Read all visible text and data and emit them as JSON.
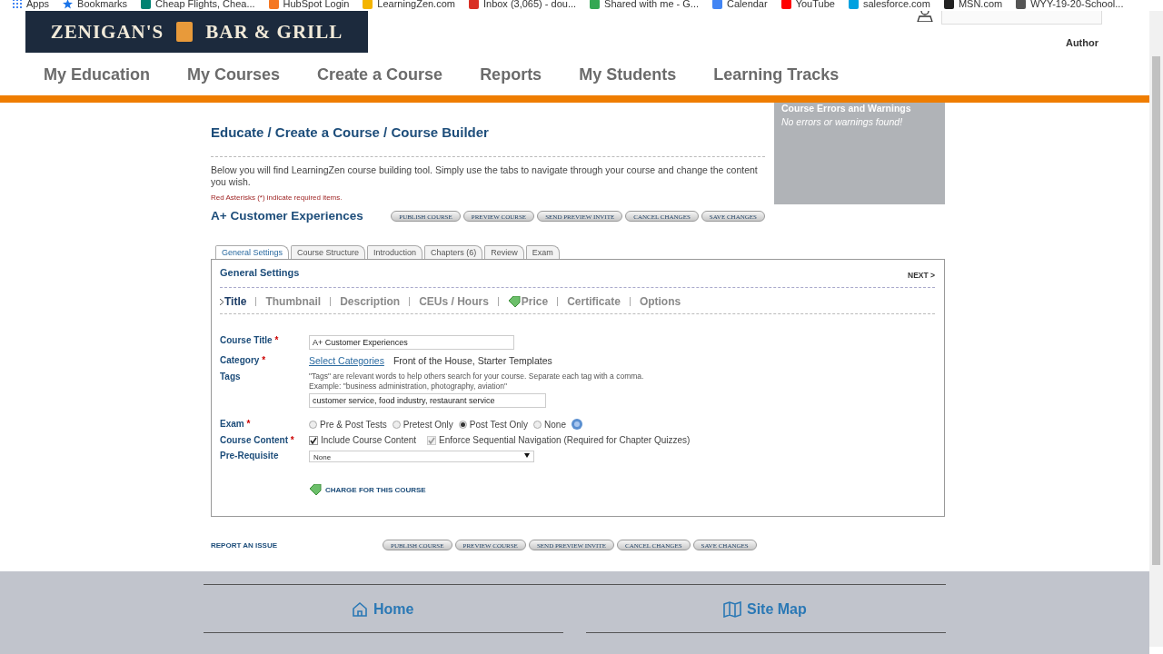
{
  "bookmarks": [
    {
      "label": "Apps",
      "kind": "grid",
      "color": "#4285f4"
    },
    {
      "label": "Bookmarks",
      "kind": "star",
      "color": "#1a73e8"
    },
    {
      "label": "Cheap Flights, Chea...",
      "kind": "square",
      "color": "#008272"
    },
    {
      "label": "HubSpot Login",
      "kind": "square",
      "color": "#f57722"
    },
    {
      "label": "LearningZen.com",
      "kind": "square",
      "color": "#f4b400"
    },
    {
      "label": "Inbox (3,065) - dou...",
      "kind": "square",
      "color": "#d93025"
    },
    {
      "label": "Shared with me - G...",
      "kind": "square",
      "color": "#34a853"
    },
    {
      "label": "Calendar",
      "kind": "square",
      "color": "#4285f4"
    },
    {
      "label": "YouTube",
      "kind": "square",
      "color": "#ff0000"
    },
    {
      "label": "salesforce.com",
      "kind": "square",
      "color": "#00a1e0"
    },
    {
      "label": "MSN.com",
      "kind": "square",
      "color": "#222222"
    },
    {
      "label": "WYY-19-20-School...",
      "kind": "square",
      "color": "#555555"
    }
  ],
  "header": {
    "logo": {
      "left": "ZENIGAN'S",
      "right": "BAR & GRILL"
    },
    "role": "Author"
  },
  "nav": [
    "My Education",
    "My Courses",
    "Create a Course",
    "Reports",
    "My Students",
    "Learning Tracks"
  ],
  "errors_panel": {
    "title": "Course Errors and Warnings",
    "message": "No errors or warnings found!"
  },
  "breadcrumb": "Educate / Create a Course / Course Builder",
  "intro": "Below you will find LearningZen course building tool. Simply use the tabs to navigate through your course and change the content you wish.",
  "required_note": "Red Asterisks (*) indicate required items.",
  "course_name": "A+ Customer Experiences",
  "action_buttons": [
    "PUBLISH COURSE",
    "PREVIEW COURSE",
    "SEND PREVIEW INVITE",
    "CANCEL CHANGES",
    "SAVE CHANGES"
  ],
  "tabs": [
    {
      "label": "General Settings",
      "selected": true
    },
    {
      "label": "Course Structure",
      "selected": false
    },
    {
      "label": "Introduction",
      "selected": false
    },
    {
      "label": "Chapters (6)",
      "selected": false
    },
    {
      "label": "Review",
      "selected": false
    },
    {
      "label": "Exam",
      "selected": false
    }
  ],
  "panel": {
    "title": "General Settings",
    "next": "NEXT >",
    "subnav": [
      {
        "label": "Title",
        "selected": true
      },
      {
        "label": "Thumbnail",
        "selected": false
      },
      {
        "label": "Description",
        "selected": false
      },
      {
        "label": "CEUs / Hours",
        "selected": false
      },
      {
        "label": "Price",
        "selected": false,
        "kind": "priced"
      },
      {
        "label": "Certificate",
        "selected": false
      },
      {
        "label": "Options",
        "selected": false
      }
    ],
    "course_title": {
      "label": "Course Title",
      "required_mark": "*",
      "value": "A+ Customer Experiences"
    },
    "category": {
      "label": "Category",
      "required_mark": "*",
      "link": "Select Categories",
      "value": "Front of the House, Starter Templates"
    },
    "tags": {
      "label": "Tags",
      "help": "\"Tags\" are relevant words to help others search for your course. Separate each tag with a comma.",
      "example": "Example: \"business administration, photography, aviation\"",
      "value": "customer service, food industry, restaurant service"
    },
    "exam": {
      "label": "Exam",
      "required_mark": "*",
      "options": [
        {
          "label": "Pre & Post Tests",
          "selected": false
        },
        {
          "label": "Pretest Only",
          "selected": false
        },
        {
          "label": "Post Test Only",
          "selected": true
        },
        {
          "label": "None",
          "selected": false
        }
      ]
    },
    "course_content": {
      "label": "Course Content",
      "required_mark": "*",
      "options": [
        {
          "label": "Include Course Content",
          "checked": true,
          "disabled": false
        },
        {
          "label": "Enforce Sequential Navigation (Required for Chapter Quizzes)",
          "checked": true,
          "disabled": true
        }
      ]
    },
    "prerequisite": {
      "label": "Pre-Requisite",
      "value": "None"
    },
    "charge_link": "CHARGE FOR THIS COURSE"
  },
  "report_link": "REPORT AN ISSUE",
  "bottom_buttons": [
    "PUBLISH COURSE",
    "PREVIEW COURSE",
    "SEND PREVIEW INVITE",
    "CANCEL CHANGES",
    "SAVE CHANGES"
  ],
  "footer_links": [
    {
      "label": "Home",
      "kind": "home"
    },
    {
      "label": "Site Map",
      "kind": "map"
    }
  ]
}
